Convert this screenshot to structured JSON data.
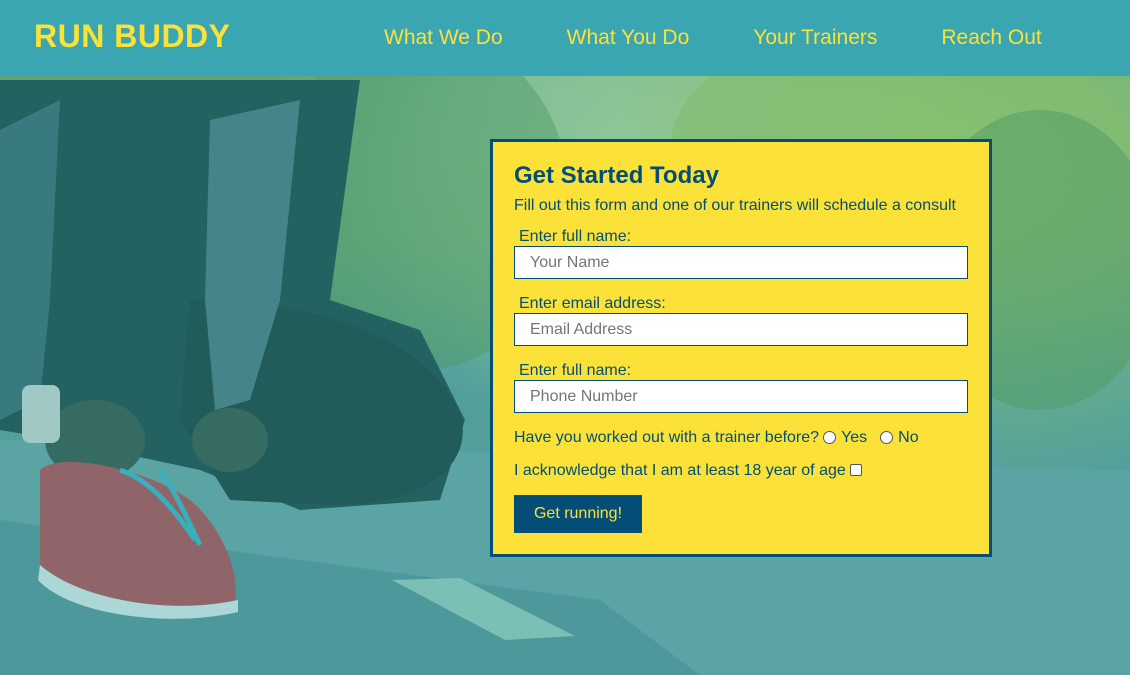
{
  "brand": {
    "name": "RUN BUDDY"
  },
  "nav": {
    "items": [
      {
        "label": "What We Do"
      },
      {
        "label": "What You Do"
      },
      {
        "label": "Your Trainers"
      },
      {
        "label": "Reach Out"
      }
    ]
  },
  "form": {
    "title": "Get Started Today",
    "subtitle": "Fill out this form and one of our trainers will schedule a consult",
    "fields": [
      {
        "label": "Enter full name:",
        "placeholder": "Your Name"
      },
      {
        "label": "Enter email address:",
        "placeholder": "Email Address"
      },
      {
        "label": "Enter full name:",
        "placeholder": "Phone Number"
      }
    ],
    "trainer_question": "Have you worked out with a trainer before?",
    "option_yes": "Yes",
    "option_no": "No",
    "acknowledge": "I acknowledge that I am at least 18 year of age",
    "submit_label": "Get running!"
  },
  "colors": {
    "header_bg": "#39a6b2",
    "brand_yellow": "#fce138",
    "navy": "#024e76"
  },
  "background": {
    "image": "runner-tying-shoe-photo"
  }
}
